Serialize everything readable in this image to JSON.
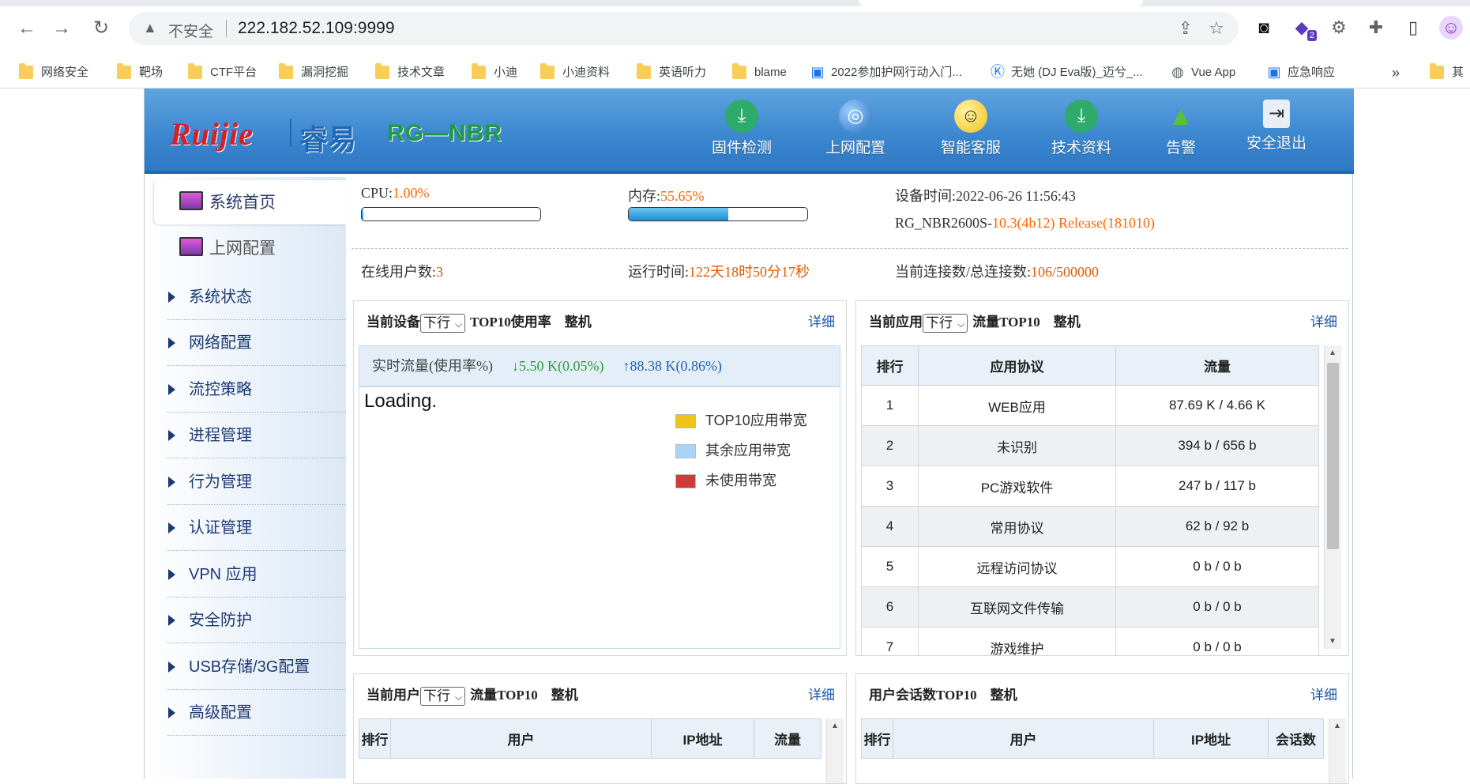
{
  "browser": {
    "back": "←",
    "forward": "→",
    "reload": "↻",
    "insecure_label": "不安全",
    "url": "222.182.52.109:9999",
    "ext_badge": "2",
    "bookmarks": [
      {
        "label": "网络安全",
        "type": "folder"
      },
      {
        "label": "靶场",
        "type": "folder"
      },
      {
        "label": "CTF平台",
        "type": "folder"
      },
      {
        "label": "漏洞挖掘",
        "type": "folder"
      },
      {
        "label": "技术文章",
        "type": "folder"
      },
      {
        "label": "小迪",
        "type": "folder"
      },
      {
        "label": "小迪资料",
        "type": "folder"
      },
      {
        "label": "英语听力",
        "type": "folder"
      },
      {
        "label": "blame",
        "type": "folder"
      },
      {
        "label": "2022参加护网行动入门...",
        "type": "bilibili"
      },
      {
        "label": "无她 (DJ Eva版)_迈兮_...",
        "type": "kugou"
      },
      {
        "label": "Vue App",
        "type": "globe"
      },
      {
        "label": "应急响应",
        "type": "bilibili"
      }
    ],
    "bookmarks_overflow": "»",
    "bookmarks_extra": "其"
  },
  "header": {
    "brand_en": "Ruijie",
    "brand_cn": "睿易",
    "model": "RG—NBR",
    "nav": [
      {
        "label": "固件检测",
        "icon": "download-icon",
        "color": "#2eaa6a"
      },
      {
        "label": "上网配置",
        "icon": "globe-icon",
        "color": "#2a6fc0"
      },
      {
        "label": "智能客服",
        "icon": "smiley-icon",
        "color": "#f2c21a"
      },
      {
        "label": "技术资料",
        "icon": "download-icon",
        "color": "#2eaa6a"
      },
      {
        "label": "告警",
        "icon": "warning-icon",
        "color": "#5cbf3a"
      },
      {
        "label": "安全退出",
        "icon": "exit-icon",
        "color": "#e8eef5"
      }
    ]
  },
  "sidebar": {
    "top": [
      {
        "label": "系统首页"
      },
      {
        "label": "上网配置"
      }
    ],
    "items": [
      {
        "label": "系统状态"
      },
      {
        "label": "网络配置"
      },
      {
        "label": "流控策略"
      },
      {
        "label": "进程管理"
      },
      {
        "label": "行为管理"
      },
      {
        "label": "认证管理"
      },
      {
        "label": "VPN 应用"
      },
      {
        "label": "安全防护"
      },
      {
        "label": "USB存储/3G配置"
      },
      {
        "label": "高级配置"
      }
    ]
  },
  "status": {
    "cpu_label": "CPU:",
    "cpu_value": "1.00%",
    "cpu_fraction": 0.01,
    "mem_label": "内存:",
    "mem_value": "55.65%",
    "mem_fraction": 0.5565,
    "time_label": "设备时间:",
    "time_value": "2022-06-26 11:56:43",
    "version_prefix": "RG_NBR2600S-",
    "version_value": "10.3(4b12) Release(181010)",
    "users_label": "在线用户数:",
    "users_value": "3",
    "uptime_label": "运行时间:",
    "uptime_value": "122天18时50分17秒",
    "conn_label": "当前连接数/总连接数:",
    "conn_value": "106/500000"
  },
  "panel_device": {
    "title_prefix": "当前设备",
    "select": "下行",
    "title_suffix": "TOP10使用率　整机",
    "detail": "详细",
    "realtime_label": "实时流量(使用率%)",
    "down": "↓5.50 K(0.05%)",
    "up": "↑88.38 K(0.86%)",
    "loading": "Loading.",
    "legend": [
      {
        "label": "TOP10应用带宽",
        "color": "#f0c419"
      },
      {
        "label": "其余应用带宽",
        "color": "#a9d4f5"
      },
      {
        "label": "未使用带宽",
        "color": "#cf3b3b"
      }
    ]
  },
  "panel_app": {
    "title_prefix": "当前应用",
    "select": "下行",
    "title_suffix": "流量TOP10　整机",
    "detail": "详细",
    "columns": [
      "排行",
      "应用协议",
      "流量"
    ],
    "rows": [
      {
        "rank": "1",
        "app": "WEB应用",
        "flow": "87.69 K / 4.66 K"
      },
      {
        "rank": "2",
        "app": "未识别",
        "flow": "394 b / 656 b"
      },
      {
        "rank": "3",
        "app": "PC游戏软件",
        "flow": "247 b / 117 b"
      },
      {
        "rank": "4",
        "app": "常用协议",
        "flow": "62 b / 92 b"
      },
      {
        "rank": "5",
        "app": "远程访问协议",
        "flow": "0 b / 0 b"
      },
      {
        "rank": "6",
        "app": "互联网文件传输",
        "flow": "0 b / 0 b"
      },
      {
        "rank": "7",
        "app": "游戏维护",
        "flow": "0 b / 0 b"
      }
    ]
  },
  "panel_user": {
    "title_prefix": "当前用户",
    "select": "下行",
    "title_suffix": "流量TOP10　整机",
    "detail": "详细",
    "columns": [
      "排行",
      "用户",
      "IP地址",
      "流量"
    ]
  },
  "panel_session": {
    "title": "用户会话数TOP10　整机",
    "detail": "详细",
    "columns": [
      "排行",
      "用户",
      "IP地址",
      "会话数"
    ]
  }
}
